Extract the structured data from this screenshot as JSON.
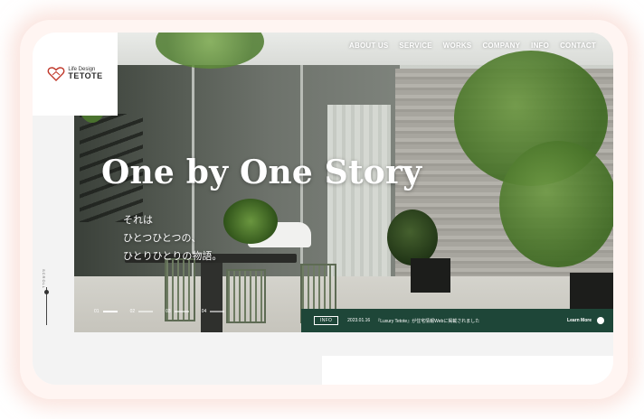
{
  "brand": {
    "sub": "Life Design",
    "name": "TETOTE",
    "accent": "#c0392b"
  },
  "nav": {
    "items": [
      "ABOUT US",
      "SERVICE",
      "WORKS",
      "COMPANY",
      "INFO",
      "CONTACT"
    ]
  },
  "hero": {
    "title": "One by One Story",
    "lines": [
      "それは",
      "ひとつひとつの、",
      "ひとりひとりの物語。"
    ]
  },
  "scroll": {
    "label": "SCROLL"
  },
  "pager": {
    "items": [
      "01",
      "02",
      "03",
      "04"
    ],
    "active_index": 0
  },
  "info": {
    "badge": "INFO",
    "date": "2023.01.16",
    "text": "『Luxury Tetote』が住宅情報Webに掲載されました",
    "more": "Learn More",
    "color": "#1e4638"
  }
}
